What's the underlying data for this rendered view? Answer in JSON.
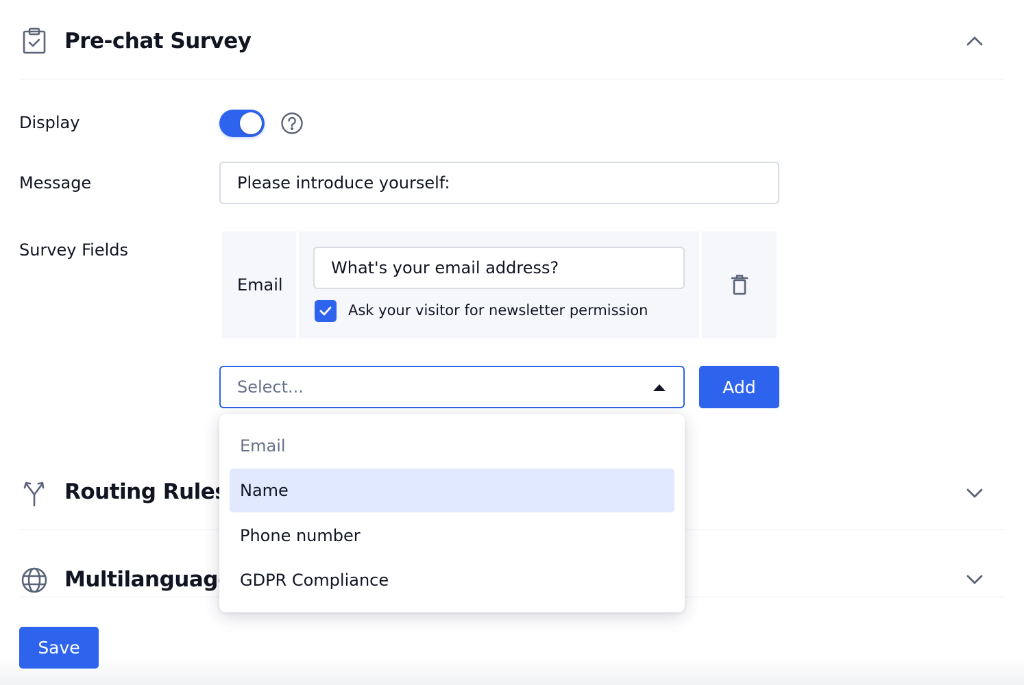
{
  "sections": {
    "prechat": {
      "title": "Pre-chat Survey",
      "icon": "clipboard-check-icon"
    },
    "routing": {
      "title": "Routing Rules f",
      "icon": "routing-split-icon"
    },
    "multilanguage": {
      "title": "Multilanguage",
      "icon": "globe-icon"
    }
  },
  "form": {
    "display_label": "Display",
    "display_enabled": true,
    "message_label": "Message",
    "message_value": "Please introduce yourself:",
    "survey_fields_label": "Survey Fields"
  },
  "survey_field": {
    "name": "Email",
    "question": "What's your email address?",
    "newsletter_checked": true,
    "newsletter_label": "Ask your visitor for newsletter permission"
  },
  "select": {
    "placeholder": "Select...",
    "options": [
      {
        "label": "Email",
        "state": "disabled"
      },
      {
        "label": "Name",
        "state": "highlighted"
      },
      {
        "label": "Phone number",
        "state": "normal"
      },
      {
        "label": "GDPR Compliance",
        "state": "normal"
      }
    ]
  },
  "buttons": {
    "add": "Add",
    "save": "Save"
  },
  "colors": {
    "accent": "#2e63ee",
    "highlight": "#e0e9fd",
    "panel": "#f5f7fb"
  }
}
